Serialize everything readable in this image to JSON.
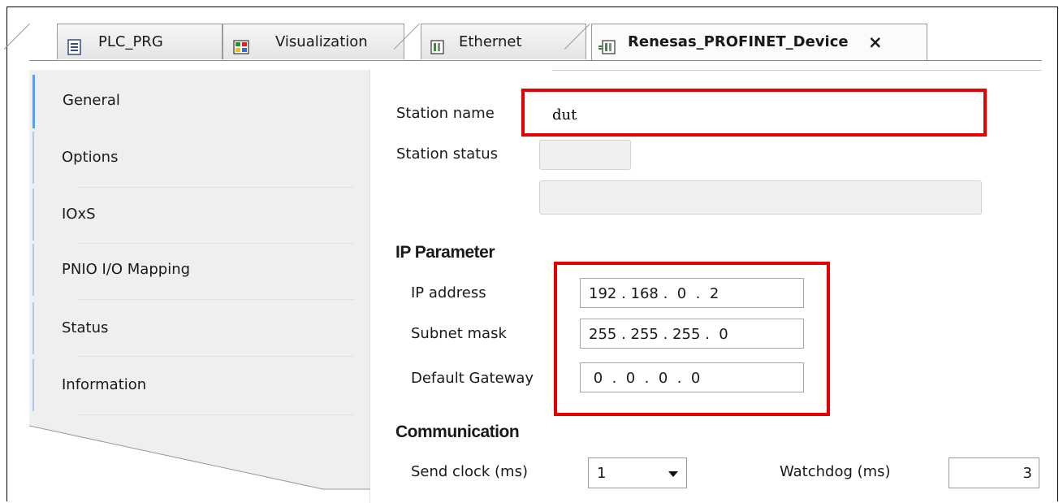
{
  "tabs": [
    {
      "label": "PLC_PRG",
      "icon": "document-icon"
    },
    {
      "label": "Visualization",
      "icon": "visualization-icon"
    },
    {
      "label": "Ethernet",
      "icon": "device-icon"
    },
    {
      "label": "Renesas_PROFINET_Device",
      "icon": "profinet-device-icon",
      "active": true,
      "close": "×"
    }
  ],
  "sidebar": {
    "items": [
      {
        "label": "General",
        "selected": true
      },
      {
        "label": "Options"
      },
      {
        "label": "IOxS"
      },
      {
        "label": "PNIO I/O Mapping"
      },
      {
        "label": "Status"
      },
      {
        "label": "Information"
      }
    ]
  },
  "general": {
    "station_name_label": "Station name",
    "station_name_value": "dut",
    "station_status_label": "Station status"
  },
  "ip": {
    "heading": "IP Parameter",
    "address_label": "IP address",
    "address_value": "192 . 168 .  0  .  2",
    "subnet_label": "Subnet mask",
    "subnet_value": "255 . 255 . 255 .  0",
    "gateway_label": "Default Gateway",
    "gateway_value": " 0  .  0  .  0  .  0"
  },
  "communication": {
    "heading": "Communication",
    "send_clock_label": "Send clock (ms)",
    "send_clock_value": "1",
    "watchdog_label": "Watchdog (ms)",
    "watchdog_value": "3"
  },
  "colors": {
    "highlight_box": "#e60000",
    "selected_tab_indicator": "#5d9ee6"
  }
}
